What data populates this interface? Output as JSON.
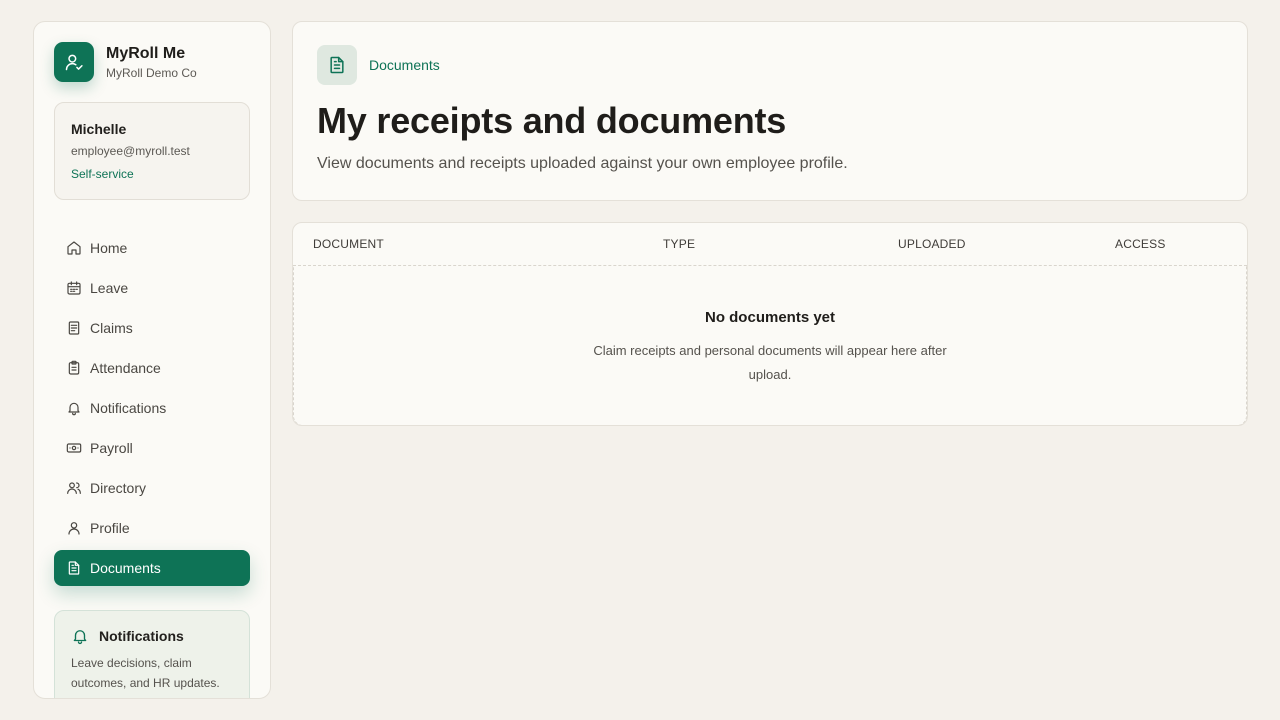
{
  "brand": {
    "name": "MyRoll Me",
    "company": "MyRoll Demo Co",
    "logo_icon": "user-check-icon"
  },
  "user": {
    "name": "Michelle",
    "email": "employee@myroll.test",
    "role": "Self-service"
  },
  "nav": {
    "items": [
      {
        "label": "Home",
        "icon": "home-icon"
      },
      {
        "label": "Leave",
        "icon": "calendar-icon"
      },
      {
        "label": "Claims",
        "icon": "receipt-icon"
      },
      {
        "label": "Attendance",
        "icon": "clipboard-icon"
      },
      {
        "label": "Notifications",
        "icon": "bell-icon"
      },
      {
        "label": "Payroll",
        "icon": "banknote-icon"
      },
      {
        "label": "Directory",
        "icon": "users-icon"
      },
      {
        "label": "Profile",
        "icon": "user-icon"
      },
      {
        "label": "Documents",
        "icon": "file-text-icon",
        "active": true
      }
    ]
  },
  "notif_card": {
    "title": "Notifications",
    "text": "Leave decisions, claim outcomes, and HR updates."
  },
  "header": {
    "crumb": "Documents",
    "title": "My receipts and documents",
    "description": "View documents and receipts uploaded against your own employee profile."
  },
  "table": {
    "columns": [
      "DOCUMENT",
      "TYPE",
      "UPLOADED",
      "ACCESS"
    ],
    "empty_title": "No documents yet",
    "empty_text": "Claim receipts and personal documents will appear here after upload."
  },
  "colors": {
    "accent": "#0e7356",
    "background": "#f4f1eb",
    "card": "#fbfaf6"
  }
}
